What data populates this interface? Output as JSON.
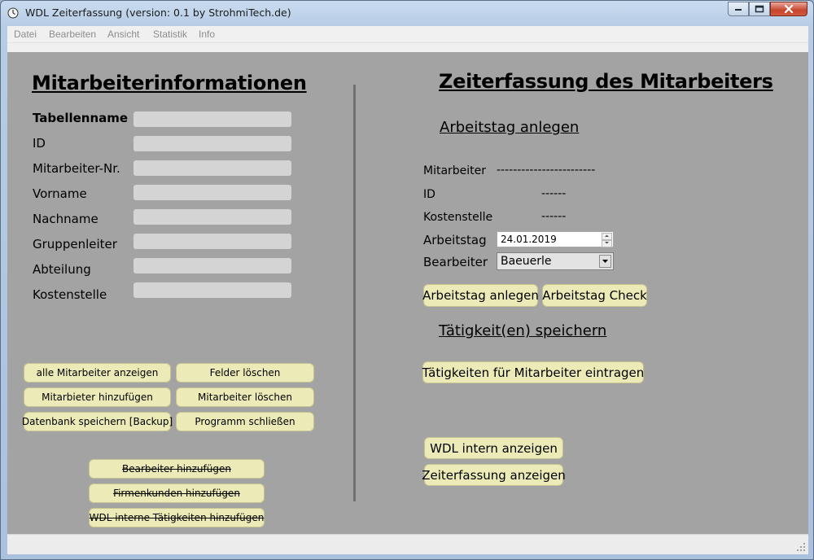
{
  "window": {
    "title": "WDL Zeiterfassung (version: 0.1 by StrohmiTech.de)"
  },
  "menu": {
    "items": [
      "Datei",
      "Bearbeiten",
      "Ansicht",
      "Statistik",
      "Info"
    ]
  },
  "left": {
    "heading": "Mitarbeiterinformationen",
    "fields": [
      {
        "label": "Tabellenname",
        "value": ""
      },
      {
        "label": "ID",
        "value": ""
      },
      {
        "label": "Mitarbeiter-Nr.",
        "value": ""
      },
      {
        "label": "Vorname",
        "value": ""
      },
      {
        "label": "Nachname",
        "value": ""
      },
      {
        "label": "Gruppenleiter",
        "value": ""
      },
      {
        "label": "Abteilung",
        "value": ""
      },
      {
        "label": "Kostenstelle",
        "value": ""
      }
    ],
    "buttons": {
      "show_all": "alle Mitarbeiter anzeigen",
      "clear_fields": "Felder löschen",
      "add_employee": "Mitarbieter hinzufügen",
      "delete_employee": "Mitarbeiter löschen",
      "save_db": "Datenbank speichern [Backup]",
      "close_program": "Programm schließen",
      "add_editor": "Bearbeiter hinzufügen",
      "add_customers": "Firmenkunden hinzufügen",
      "add_internal_tasks": "WDL interne Tätigkeiten hinzufügen"
    }
  },
  "right": {
    "heading": "Zeiterfassung des Mitarbeiters",
    "section_workday": "Arbeitstag anlegen",
    "info": {
      "mitarbeiter_label": "Mitarbeiter",
      "mitarbeiter_value": "------------------------",
      "id_label": "ID",
      "id_value": "------",
      "kostenstelle_label": "Kostenstelle",
      "kostenstelle_value": "------"
    },
    "arbeitstag_label": "Arbeitstag",
    "arbeitstag_value": "24.01.2019",
    "bearbeiter_label": "Bearbeiter",
    "bearbeiter_value": "Baeuerle",
    "buttons": {
      "create_workday": "Arbeitstag anlegen",
      "check_workday": "Arbeitstag Check",
      "enter_activities": "Tätigkeiten für Mitarbeiter eintragen",
      "show_internal": "WDL intern anzeigen",
      "show_time": "Zeiterfassung anzeigen"
    },
    "section_activities": "Tätigkeit(en) speichern"
  },
  "colors": {
    "content_bg": "#a3a3a3",
    "button_bg": "#ecebb8",
    "field_bg": "#d4d4d4",
    "close_button": "#c6452d"
  }
}
